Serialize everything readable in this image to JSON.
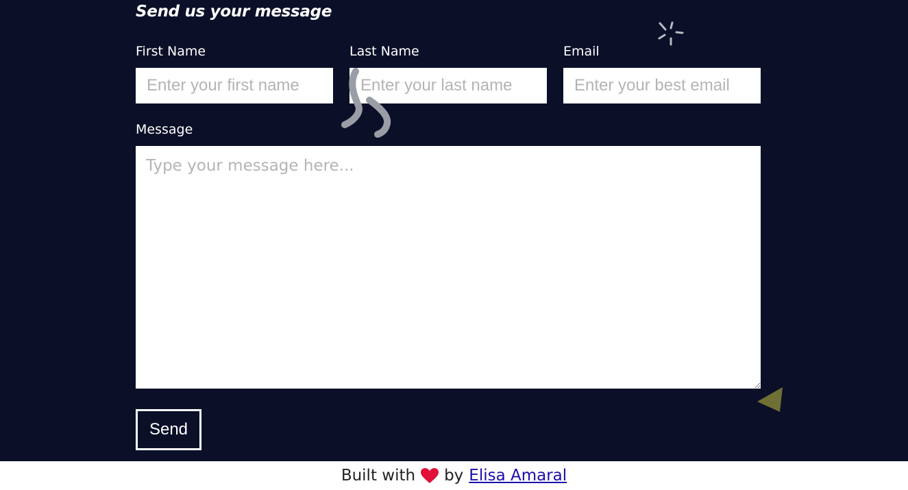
{
  "form": {
    "title": "Send us your message",
    "first_name": {
      "label": "First Name",
      "placeholder": "Enter your first name",
      "value": ""
    },
    "last_name": {
      "label": "Last Name",
      "placeholder": "Enter your last name",
      "value": ""
    },
    "email": {
      "label": "Email",
      "placeholder": "Enter your best email",
      "value": ""
    },
    "message": {
      "label": "Message",
      "placeholder": "Type your message here...",
      "value": ""
    },
    "send_label": "Send"
  },
  "decorations": {
    "burst_icon": "burst-icon",
    "squiggle_icon": "squiggle-icon",
    "triangle_icon": "triangle-icon",
    "squiggle_color": "#9a9ca6",
    "burst_color": "#b9bbc3",
    "triangle_color": "#6f7033"
  },
  "footer": {
    "prefix": "Built with",
    "heart_icon": "heart-icon",
    "heart_color": "#e0103a",
    "by": "by",
    "author": "Elisa Amaral"
  },
  "colors": {
    "background": "#0b1028",
    "footer_background": "#ffffff"
  }
}
